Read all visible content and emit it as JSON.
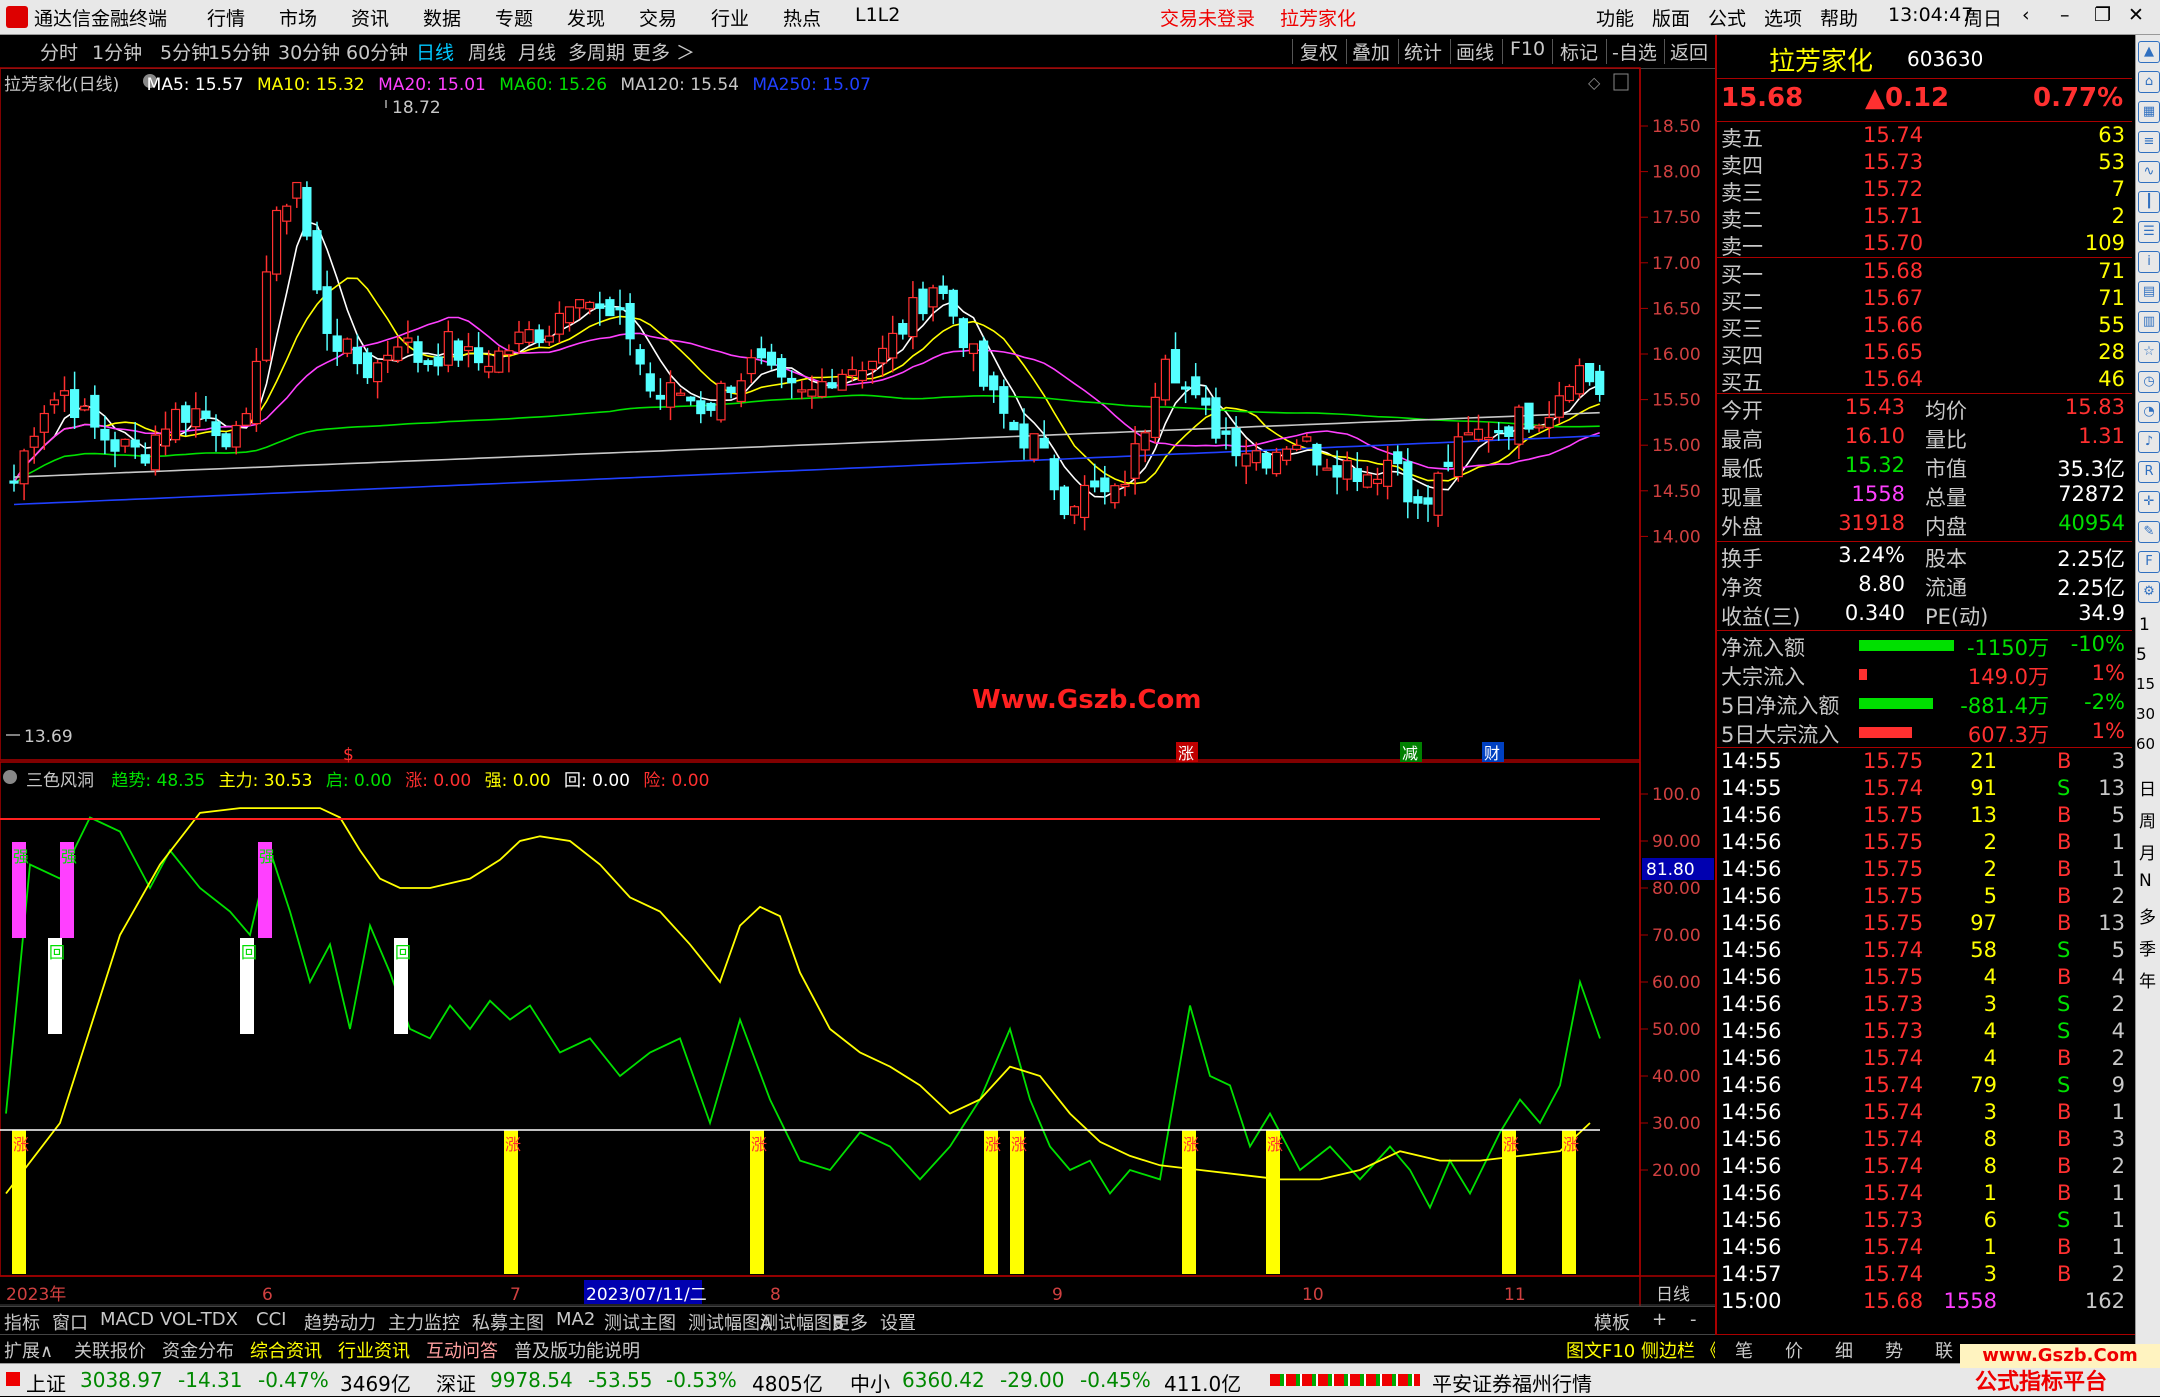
{
  "app": {
    "title": "通达信金融终端",
    "menu": [
      "行情",
      "市场",
      "资讯",
      "数据",
      "专题",
      "发现",
      "交易",
      "行业",
      "热点",
      "L1L2"
    ],
    "login_status": "交易未登录",
    "stock_title": "拉芳家化",
    "right_menu": [
      "功能",
      "版面",
      "公式",
      "选项",
      "帮助"
    ],
    "time": "13:04:47",
    "weekday": "周日"
  },
  "toolbar": {
    "periods": [
      "分时",
      "1分钟",
      "5分钟",
      "15分钟",
      "30分钟",
      "60分钟",
      "日线",
      "周线",
      "月线",
      "多周期",
      "更多 ＞"
    ],
    "active_period": "日线",
    "right": [
      "复权",
      "叠加",
      "统计",
      "画线",
      "F10",
      "标记",
      "-自选",
      "返回"
    ]
  },
  "main_chart": {
    "title": "拉芳家化(日线)",
    "ma": [
      {
        "label": "MA5: 15.57",
        "color": "#ffffff"
      },
      {
        "label": "MA10: 15.32",
        "color": "#ffff00"
      },
      {
        "label": "MA20: 15.01",
        "color": "#ff40ff"
      },
      {
        "label": "MA60: 15.26",
        "color": "#00e000"
      },
      {
        "label": "MA120: 15.54",
        "color": "#c8c8c8"
      },
      {
        "label": "MA250: 15.07",
        "color": "#2040ff"
      }
    ],
    "y_ticks": [
      "18.50",
      "18.00",
      "17.50",
      "17.00",
      "16.50",
      "16.00",
      "15.50",
      "15.00",
      "14.50",
      "14.00"
    ],
    "high_label": "18.72",
    "low_label": "13.69",
    "watermark": "Www.Gszb.Com",
    "markers": [
      "$",
      "涨",
      "减",
      "财"
    ]
  },
  "indicator": {
    "name": "三色风洞",
    "values": [
      {
        "label": "趋势: 48.35",
        "color": "#00e000"
      },
      {
        "label": "主力: 30.53",
        "color": "#ffff00"
      },
      {
        "label": "启: 0.00",
        "color": "#00e000"
      },
      {
        "label": "涨: 0.00",
        "color": "#ff3030"
      },
      {
        "label": "强: 0.00",
        "color": "#ffff00"
      },
      {
        "label": "回: 0.00",
        "color": "#ffffff"
      },
      {
        "label": "险: 0.00",
        "color": "#ff3030"
      }
    ],
    "y_ticks": [
      "100.0",
      "90.00",
      "80.00",
      "70.00",
      "60.00",
      "50.00",
      "40.00",
      "30.00",
      "20.00"
    ],
    "current": "81.80",
    "bar_labels": {
      "strong": "强",
      "back": "回",
      "up": "涨"
    }
  },
  "x_axis": {
    "labels": [
      "2023年",
      "6",
      "7",
      "2023/07/11/二",
      "8",
      "9",
      "10",
      "11"
    ],
    "period": "日线"
  },
  "bottom_tabs_1": [
    "指标",
    "窗口",
    "MACD",
    "VOL-TDX",
    "CCI",
    "趋势动力",
    "主力监控",
    "私募主图",
    "MA2",
    "测试主图",
    "测试幅图A",
    "测试幅图B",
    "更多",
    "设置"
  ],
  "bottom_tabs_1_right": [
    "模板",
    "+",
    "-"
  ],
  "bottom_tabs_2": [
    "扩展∧",
    "关联报价",
    "资金分布",
    "综合资讯",
    "行业资讯",
    "互动问答",
    "普及版功能说明"
  ],
  "bottom_tabs_2_right": "图文F10 侧边栏 《",
  "quote": {
    "name": "拉芳家化",
    "code": "603630",
    "price": "15.68",
    "change": "▲0.12",
    "pct": "0.77%",
    "asks": [
      {
        "l": "卖五",
        "p": "15.74",
        "v": "63"
      },
      {
        "l": "卖四",
        "p": "15.73",
        "v": "53"
      },
      {
        "l": "卖三",
        "p": "15.72",
        "v": "7"
      },
      {
        "l": "卖二",
        "p": "15.71",
        "v": "2"
      },
      {
        "l": "卖一",
        "p": "15.70",
        "v": "109"
      }
    ],
    "bids": [
      {
        "l": "买一",
        "p": "15.68",
        "v": "71"
      },
      {
        "l": "买二",
        "p": "15.67",
        "v": "71"
      },
      {
        "l": "买三",
        "p": "15.66",
        "v": "55"
      },
      {
        "l": "买四",
        "p": "15.65",
        "v": "28"
      },
      {
        "l": "买五",
        "p": "15.64",
        "v": "46"
      }
    ],
    "stats": [
      {
        "l1": "今开",
        "v1": "15.43",
        "c1": "rd",
        "l2": "均价",
        "v2": "15.83",
        "c2": "rd"
      },
      {
        "l1": "最高",
        "v1": "16.10",
        "c1": "rd",
        "l2": "量比",
        "v2": "1.31",
        "c2": "rd"
      },
      {
        "l1": "最低",
        "v1": "15.32",
        "c1": "gn",
        "l2": "市值",
        "v2": "35.3亿",
        "c2": "wt"
      },
      {
        "l1": "现量",
        "v1": "1558",
        "c1": "mg",
        "l2": "总量",
        "v2": "72872",
        "c2": "wt"
      },
      {
        "l1": "外盘",
        "v1": "31918",
        "c1": "rd",
        "l2": "内盘",
        "v2": "40954",
        "c2": "gn"
      }
    ],
    "stats2": [
      {
        "l1": "换手",
        "v1": "3.24%",
        "l2": "股本",
        "v2": "2.25亿"
      },
      {
        "l1": "净资",
        "v1": "8.80",
        "l2": "流通",
        "v2": "2.25亿"
      },
      {
        "l1": "收益(三)",
        "v1": "0.340",
        "l2": "PE(动)",
        "v2": "34.9"
      }
    ],
    "flows": [
      {
        "l": "净流入额",
        "v": "-1150万",
        "p": "-10%",
        "c": "gn",
        "bar": 0.9
      },
      {
        "l": "大宗流入",
        "v": "149.0万",
        "p": "1%",
        "c": "rd",
        "bar": 0.08
      },
      {
        "l": "5日净流入额",
        "v": "-881.4万",
        "p": "-2%",
        "c": "gn",
        "bar": 0.7
      },
      {
        "l": "5日大宗流入",
        "v": "607.3万",
        "p": "1%",
        "c": "rd",
        "bar": 0.5
      }
    ],
    "ticks": [
      {
        "t": "14:55",
        "p": "15.75",
        "v": "21",
        "s": "B",
        "n": "3"
      },
      {
        "t": "14:55",
        "p": "15.74",
        "v": "91",
        "s": "S",
        "n": "13"
      },
      {
        "t": "14:56",
        "p": "15.75",
        "v": "13",
        "s": "B",
        "n": "5"
      },
      {
        "t": "14:56",
        "p": "15.75",
        "v": "2",
        "s": "B",
        "n": "1"
      },
      {
        "t": "14:56",
        "p": "15.75",
        "v": "2",
        "s": "B",
        "n": "1"
      },
      {
        "t": "14:56",
        "p": "15.75",
        "v": "5",
        "s": "B",
        "n": "2"
      },
      {
        "t": "14:56",
        "p": "15.75",
        "v": "97",
        "s": "B",
        "n": "13"
      },
      {
        "t": "14:56",
        "p": "15.74",
        "v": "58",
        "s": "S",
        "n": "5"
      },
      {
        "t": "14:56",
        "p": "15.75",
        "v": "4",
        "s": "B",
        "n": "4"
      },
      {
        "t": "14:56",
        "p": "15.73",
        "v": "3",
        "s": "S",
        "n": "2"
      },
      {
        "t": "14:56",
        "p": "15.73",
        "v": "4",
        "s": "S",
        "n": "4"
      },
      {
        "t": "14:56",
        "p": "15.74",
        "v": "4",
        "s": "B",
        "n": "2"
      },
      {
        "t": "14:56",
        "p": "15.74",
        "v": "79",
        "s": "S",
        "n": "9"
      },
      {
        "t": "14:56",
        "p": "15.74",
        "v": "3",
        "s": "B",
        "n": "1"
      },
      {
        "t": "14:56",
        "p": "15.74",
        "v": "8",
        "s": "B",
        "n": "3"
      },
      {
        "t": "14:56",
        "p": "15.74",
        "v": "8",
        "s": "B",
        "n": "2"
      },
      {
        "t": "14:56",
        "p": "15.74",
        "v": "1",
        "s": "B",
        "n": "1"
      },
      {
        "t": "14:56",
        "p": "15.73",
        "v": "6",
        "s": "S",
        "n": "1"
      },
      {
        "t": "14:56",
        "p": "15.74",
        "v": "1",
        "s": "B",
        "n": "1"
      },
      {
        "t": "14:57",
        "p": "15.74",
        "v": "3",
        "s": "B",
        "n": "2"
      },
      {
        "t": "15:00",
        "p": "15.68",
        "v": "1558",
        "s": "",
        "n": "162"
      }
    ],
    "tabs": [
      "笔",
      "价",
      "细",
      "势",
      "联"
    ]
  },
  "icon_column": [
    "日",
    "周",
    "月",
    "N",
    "多",
    "季",
    "年"
  ],
  "icon_numbers": [
    "1",
    "5",
    "15",
    "30",
    "60"
  ],
  "status": {
    "sh": {
      "name": "上证",
      "val": "3038.97",
      "chg": "-14.31",
      "pct": "-0.47%",
      "amt": "3469亿"
    },
    "sz": {
      "name": "深证",
      "val": "9978.54",
      "chg": "-53.55",
      "pct": "-0.53%",
      "amt": "4805亿"
    },
    "zx": {
      "name": "中小",
      "val": "6360.42",
      "chg": "-29.00",
      "pct": "-0.45%",
      "amt": "411.0亿"
    },
    "broker": "平安证券福州行情",
    "brand": "公式指标平台",
    "brand_url": "www.Gszb.Com"
  }
}
